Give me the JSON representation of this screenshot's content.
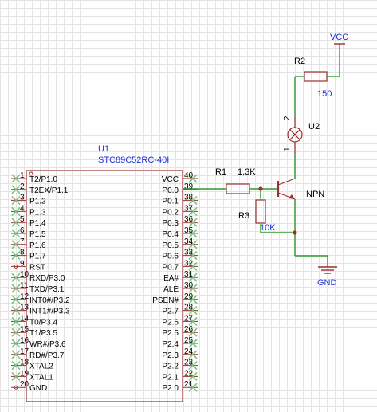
{
  "colors": {
    "wire": "#2e9b2e",
    "body": "#9a2f2f",
    "blue": "#1f2fd6",
    "nc": "#7ec07e",
    "label": "#000000"
  },
  "mcu": {
    "designator": "U1",
    "part": "STC89C52RC-40I",
    "left_pins": [
      {
        "num": "1",
        "name": "T2/P1.0"
      },
      {
        "num": "2",
        "name": "T2EX/P1.1"
      },
      {
        "num": "3",
        "name": "P1.2"
      },
      {
        "num": "4",
        "name": "P1.3"
      },
      {
        "num": "5",
        "name": "P1.4"
      },
      {
        "num": "6",
        "name": "P1.5"
      },
      {
        "num": "7",
        "name": "P1.6"
      },
      {
        "num": "8",
        "name": "P1.7"
      },
      {
        "num": "9",
        "name": "RST"
      },
      {
        "num": "10",
        "name": "RXD/P3.0"
      },
      {
        "num": "11",
        "name": "TXD/P3.1"
      },
      {
        "num": "12",
        "name": "INT0#/P3.2"
      },
      {
        "num": "13",
        "name": "INT1#/P3.3"
      },
      {
        "num": "14",
        "name": "T0/P3.4"
      },
      {
        "num": "15",
        "name": "T1/P3.5"
      },
      {
        "num": "16",
        "name": "WR#/P3.6"
      },
      {
        "num": "17",
        "name": "RD#/P3.7"
      },
      {
        "num": "18",
        "name": "XTAL2"
      },
      {
        "num": "19",
        "name": "XTAL1"
      },
      {
        "num": "20",
        "name": "GND"
      }
    ],
    "right_pins": [
      {
        "num": "40",
        "name": "VCC"
      },
      {
        "num": "39",
        "name": "P0.0"
      },
      {
        "num": "38",
        "name": "P0.1"
      },
      {
        "num": "37",
        "name": "P0.2"
      },
      {
        "num": "36",
        "name": "P0.3"
      },
      {
        "num": "35",
        "name": "P0.4"
      },
      {
        "num": "34",
        "name": "P0.5"
      },
      {
        "num": "33",
        "name": "P0.6"
      },
      {
        "num": "32",
        "name": "P0.7"
      },
      {
        "num": "31",
        "name": "EA#"
      },
      {
        "num": "30",
        "name": "ALE"
      },
      {
        "num": "29",
        "name": "PSEN#"
      },
      {
        "num": "28",
        "name": "P2.7"
      },
      {
        "num": "27",
        "name": "P2.6"
      },
      {
        "num": "26",
        "name": "P2.5"
      },
      {
        "num": "25",
        "name": "P2.4"
      },
      {
        "num": "24",
        "name": "P2.3"
      },
      {
        "num": "23",
        "name": "P2.2"
      },
      {
        "num": "22",
        "name": "P2.1"
      },
      {
        "num": "21",
        "name": "P2.0"
      }
    ]
  },
  "r1": {
    "designator": "R1",
    "value": "1.3K"
  },
  "r2": {
    "designator": "R2",
    "value": "150"
  },
  "r3": {
    "designator": "R3",
    "value": "10K"
  },
  "lamp": {
    "designator": "U2",
    "pin_top": "2",
    "pin_bottom": "1"
  },
  "transistor": {
    "type": "NPN"
  },
  "power": {
    "vcc": "VCC",
    "gnd": "GND"
  }
}
